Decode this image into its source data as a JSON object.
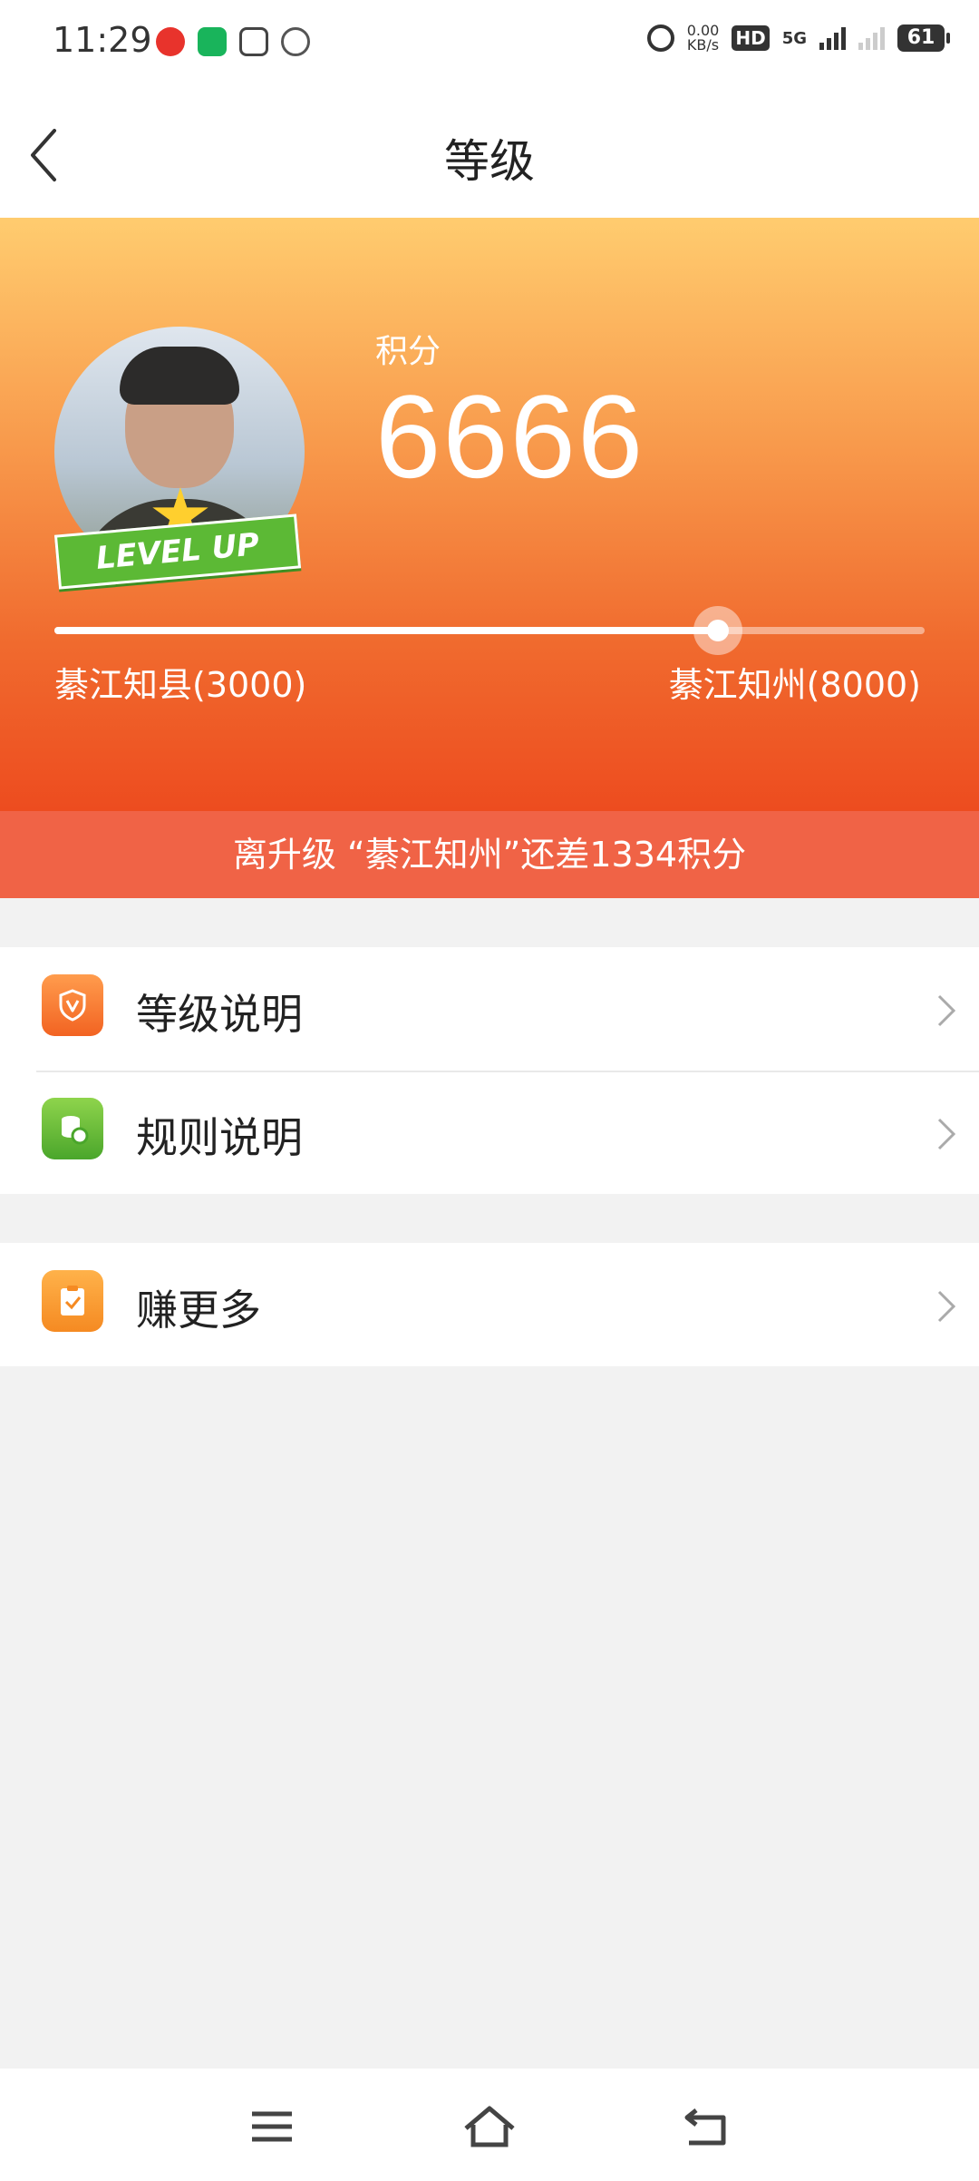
{
  "status_bar": {
    "time": "11:29",
    "net_speed_value": "0.00",
    "net_speed_unit": "KB/s",
    "hd": "HD",
    "network": "5G",
    "battery": "61",
    "app_icons": [
      "music-app-icon",
      "video-app-icon",
      "media-app-icon",
      "bilibili-style-icon"
    ]
  },
  "navbar": {
    "title": "等级",
    "back_icon": "chevron-left-icon"
  },
  "hero": {
    "score_label": "积分",
    "score_value": "6666",
    "badge_text": "LEVEL UP",
    "current_level": "綦江知县(3000)",
    "next_level": "綦江知州(8000)",
    "progress": 0.763
  },
  "hint": {
    "text": "离升级 “綦江知州”还差1334积分"
  },
  "menu": {
    "items": [
      {
        "label": "等级说明",
        "icon": "shield-icon"
      },
      {
        "label": "规则说明",
        "icon": "coins-icon"
      }
    ],
    "more": {
      "label": "赚更多",
      "icon": "clipboard-check-icon"
    }
  },
  "colors": {
    "hero_top": "#ffcc6f",
    "hero_bottom": "#ed4c1f",
    "hint_bg": "#f06346",
    "page_bg": "#f2f2f2"
  },
  "system_nav": [
    "menu-icon",
    "home-icon",
    "back-icon"
  ]
}
